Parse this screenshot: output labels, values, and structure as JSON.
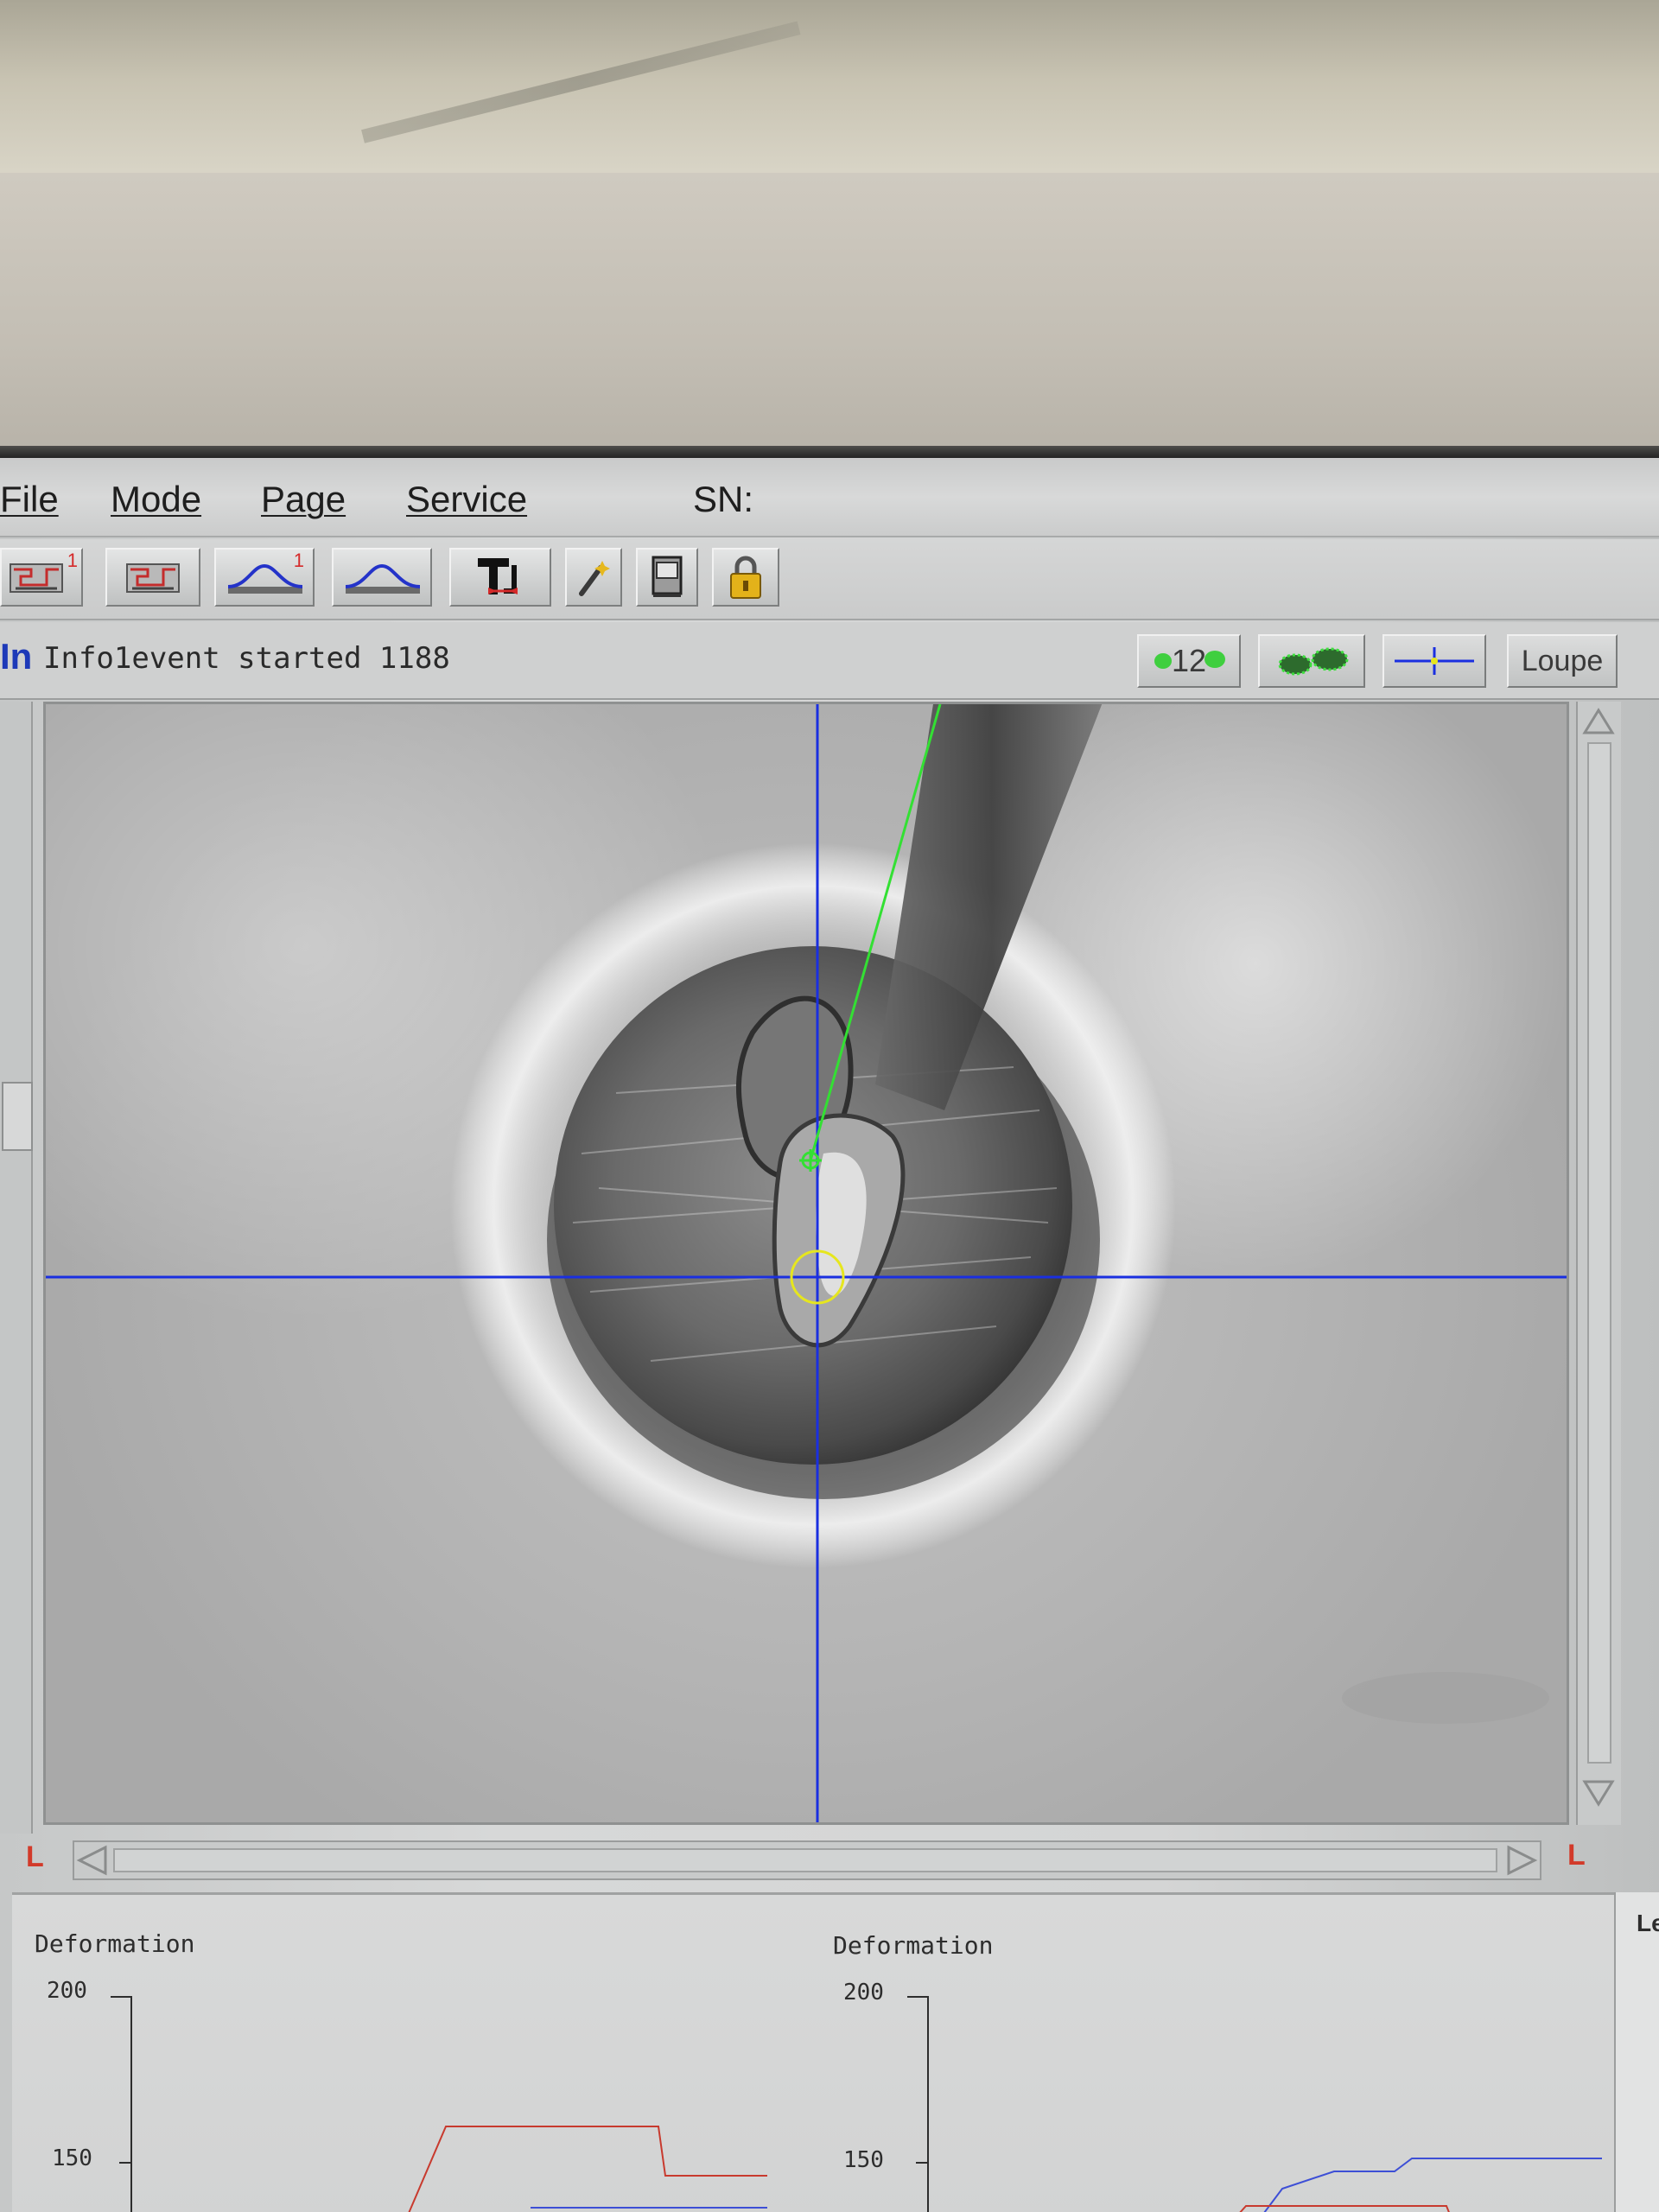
{
  "menu": {
    "file": "File",
    "mode": "Mode",
    "page": "Page",
    "service": "Service",
    "sn_label": "SN:"
  },
  "toolbar": {
    "buttons": [
      {
        "icon": "map-icon",
        "badge": "1"
      },
      {
        "icon": "map-icon",
        "badge": ""
      },
      {
        "icon": "curve-icon",
        "badge": "1"
      },
      {
        "icon": "curve-icon",
        "badge": ""
      },
      {
        "icon": "tool-icon"
      },
      {
        "icon": "magic-wand-icon"
      },
      {
        "icon": "book-icon"
      },
      {
        "icon": "lock-icon"
      }
    ]
  },
  "infobar": {
    "prefix": "In",
    "message": "Info1event started 1188",
    "step_count": "12",
    "loupe": "Loupe"
  },
  "camera": {
    "corner_marker": "L"
  },
  "graphs": {
    "left": {
      "title": "Deformation",
      "tick_200": "200",
      "tick_150": "150"
    },
    "right": {
      "title": "Deformation",
      "tick_200": "200",
      "tick_150": "150"
    },
    "edge_label": "Le"
  },
  "colors": {
    "crosshair": "#1a2fe0",
    "needle_line": "#33e033",
    "target_circle": "#e6e61e",
    "series_red": "#c83a2e",
    "series_blue": "#3d4fd6",
    "badge_red": "#d52a2a"
  }
}
